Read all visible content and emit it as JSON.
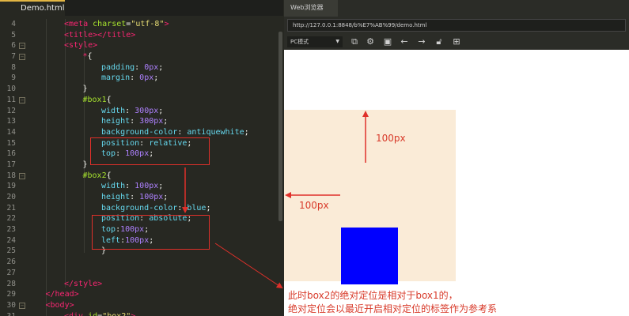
{
  "editor": {
    "tab_title": "Demo.html",
    "lines": [
      {
        "n": "4",
        "fold": false,
        "indent": 2,
        "tokens": [
          [
            "tag",
            "<meta "
          ],
          [
            "attr",
            "charset"
          ],
          [
            "plain",
            "="
          ],
          [
            "str",
            "\"utf-8\""
          ],
          [
            "tag",
            ">"
          ]
        ]
      },
      {
        "n": "5",
        "fold": false,
        "indent": 2,
        "tokens": [
          [
            "tag",
            "<title></title>"
          ]
        ]
      },
      {
        "n": "6",
        "fold": true,
        "indent": 2,
        "tokens": [
          [
            "tag",
            "<style>"
          ]
        ]
      },
      {
        "n": "7",
        "fold": true,
        "indent": 3,
        "tokens": [
          [
            "tag",
            "*"
          ],
          [
            "plain",
            "{"
          ]
        ]
      },
      {
        "n": "8",
        "fold": false,
        "indent": 4,
        "tokens": [
          [
            "prop",
            "padding"
          ],
          [
            "plain",
            ": "
          ],
          [
            "num",
            "0px"
          ],
          [
            "plain",
            ";"
          ]
        ]
      },
      {
        "n": "9",
        "fold": false,
        "indent": 4,
        "tokens": [
          [
            "prop",
            "margin"
          ],
          [
            "plain",
            ": "
          ],
          [
            "num",
            "0px"
          ],
          [
            "plain",
            ";"
          ]
        ]
      },
      {
        "n": "10",
        "fold": false,
        "indent": 3,
        "tokens": [
          [
            "plain",
            "}"
          ]
        ]
      },
      {
        "n": "11",
        "fold": true,
        "indent": 3,
        "tokens": [
          [
            "sel",
            "#box1"
          ],
          [
            "plain",
            "{"
          ]
        ]
      },
      {
        "n": "12",
        "fold": false,
        "indent": 4,
        "tokens": [
          [
            "prop",
            "width"
          ],
          [
            "plain",
            ": "
          ],
          [
            "num",
            "300px"
          ],
          [
            "plain",
            ";"
          ]
        ]
      },
      {
        "n": "13",
        "fold": false,
        "indent": 4,
        "tokens": [
          [
            "prop",
            "height"
          ],
          [
            "plain",
            ": "
          ],
          [
            "num",
            "300px"
          ],
          [
            "plain",
            ";"
          ]
        ]
      },
      {
        "n": "14",
        "fold": false,
        "indent": 4,
        "tokens": [
          [
            "prop",
            "background-color"
          ],
          [
            "plain",
            ": "
          ],
          [
            "prop",
            "antiquewhite"
          ],
          [
            "plain",
            ";"
          ]
        ]
      },
      {
        "n": "15",
        "fold": false,
        "indent": 4,
        "tokens": [
          [
            "prop",
            "position"
          ],
          [
            "plain",
            ": "
          ],
          [
            "prop",
            "relative"
          ],
          [
            "plain",
            ";"
          ]
        ]
      },
      {
        "n": "16",
        "fold": false,
        "indent": 4,
        "tokens": [
          [
            "prop",
            "top"
          ],
          [
            "plain",
            ": "
          ],
          [
            "num",
            "100px"
          ],
          [
            "plain",
            ";"
          ]
        ]
      },
      {
        "n": "17",
        "fold": false,
        "indent": 3,
        "tokens": [
          [
            "plain",
            "}"
          ]
        ]
      },
      {
        "n": "18",
        "fold": true,
        "indent": 3,
        "tokens": [
          [
            "sel",
            "#box2"
          ],
          [
            "plain",
            "{"
          ]
        ]
      },
      {
        "n": "19",
        "fold": false,
        "indent": 4,
        "tokens": [
          [
            "prop",
            "width"
          ],
          [
            "plain",
            ": "
          ],
          [
            "num",
            "100px"
          ],
          [
            "plain",
            ";"
          ]
        ]
      },
      {
        "n": "20",
        "fold": false,
        "indent": 4,
        "tokens": [
          [
            "prop",
            "height"
          ],
          [
            "plain",
            ": "
          ],
          [
            "num",
            "100px"
          ],
          [
            "plain",
            ";"
          ]
        ]
      },
      {
        "n": "21",
        "fold": false,
        "indent": 4,
        "tokens": [
          [
            "prop",
            "background-color"
          ],
          [
            "plain",
            ": "
          ],
          [
            "prop",
            "blue"
          ],
          [
            "plain",
            ";"
          ]
        ]
      },
      {
        "n": "22",
        "fold": false,
        "indent": 4,
        "tokens": [
          [
            "prop",
            "position"
          ],
          [
            "plain",
            ": "
          ],
          [
            "prop",
            "absolute"
          ],
          [
            "plain",
            ";"
          ]
        ]
      },
      {
        "n": "23",
        "fold": false,
        "indent": 4,
        "tokens": [
          [
            "prop",
            "top"
          ],
          [
            "plain",
            ":"
          ],
          [
            "num",
            "100px"
          ],
          [
            "plain",
            ";"
          ]
        ]
      },
      {
        "n": "24",
        "fold": false,
        "indent": 4,
        "tokens": [
          [
            "prop",
            "left"
          ],
          [
            "plain",
            ":"
          ],
          [
            "num",
            "100px"
          ],
          [
            "plain",
            ";"
          ]
        ]
      },
      {
        "n": "25",
        "fold": false,
        "indent": 4,
        "tokens": [
          [
            "plain",
            "}"
          ]
        ]
      },
      {
        "n": "26",
        "fold": false,
        "indent": 0,
        "tokens": []
      },
      {
        "n": "27",
        "fold": false,
        "indent": 0,
        "tokens": []
      },
      {
        "n": "28",
        "fold": false,
        "indent": 2,
        "tokens": [
          [
            "tag",
            "</style>"
          ]
        ]
      },
      {
        "n": "29",
        "fold": false,
        "indent": 1,
        "tokens": [
          [
            "tag",
            "</head>"
          ]
        ]
      },
      {
        "n": "30",
        "fold": true,
        "indent": 1,
        "tokens": [
          [
            "tag",
            "<body>"
          ]
        ]
      },
      {
        "n": "31",
        "fold": false,
        "indent": 2,
        "tokens": [
          [
            "tag",
            "<div "
          ],
          [
            "attr",
            "id"
          ],
          [
            "plain",
            "="
          ],
          [
            "str",
            "\"box2\""
          ],
          [
            "tag",
            ">"
          ]
        ]
      }
    ]
  },
  "browser": {
    "tab_title": "Web浏览器",
    "url": "http://127.0.0.1:8848/b%E7%AB%99/demo.html",
    "mode": "PC模式",
    "toolbar_icons": [
      "screenshot-icon",
      "settings-icon",
      "console-icon",
      "back-icon",
      "forward-icon",
      "lock-icon",
      "grid-icon"
    ]
  },
  "annotations": {
    "top_offset": "100px",
    "left_offset": "100px",
    "note_line1": "此时box2的绝对定位是相对于box1的，",
    "note_line2": "绝对定位会以最近开启相对定位的标签作为参考系"
  },
  "colors": {
    "annotation_red": "#e0302a",
    "box1_fill": "#faebd7",
    "box2_fill": "#0000ff"
  }
}
